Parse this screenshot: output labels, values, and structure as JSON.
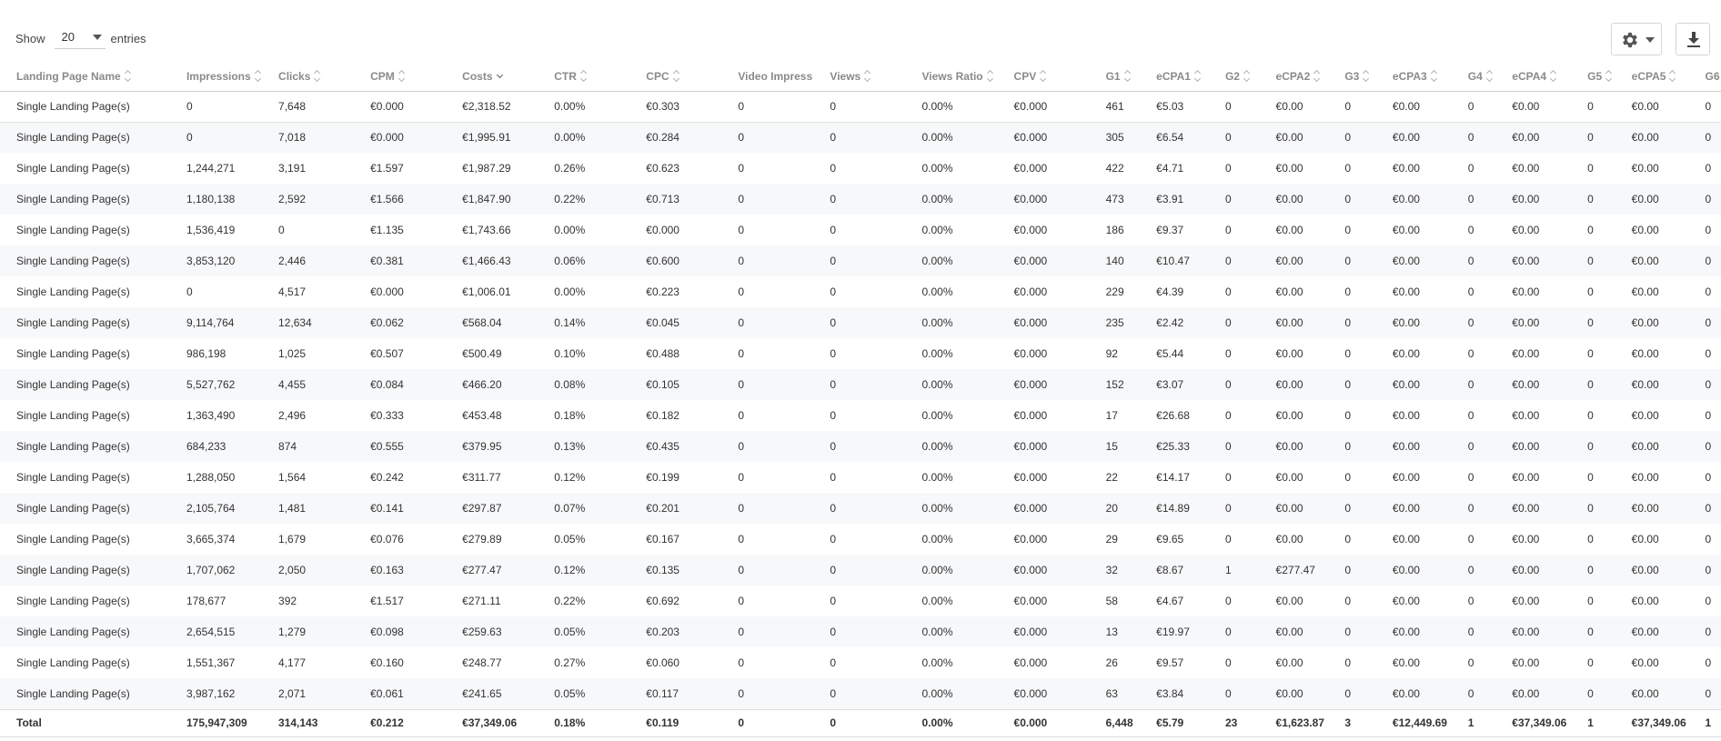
{
  "length_menu": {
    "prefix": "Show",
    "value": "20",
    "suffix": "entries"
  },
  "toolbar": {
    "settings_icon": "gear-icon",
    "download_icon": "download-icon"
  },
  "columns": [
    "Landing Page Name",
    "Impressions",
    "Clicks",
    "CPM",
    "Costs",
    "CTR",
    "CPC",
    "Video Impressions",
    "Views",
    "Views Ratio",
    "CPV",
    "G1",
    "eCPA1",
    "G2",
    "eCPA2",
    "G3",
    "eCPA3",
    "G4",
    "eCPA4",
    "G5",
    "eCPA5",
    "G6"
  ],
  "sorted_column": "Costs",
  "rows": [
    [
      "Single Landing Page(s)",
      "0",
      "7,648",
      "€0.000",
      "€2,318.52",
      "0.00%",
      "€0.303",
      "0",
      "0",
      "0.00%",
      "€0.000",
      "461",
      "€5.03",
      "0",
      "€0.00",
      "0",
      "€0.00",
      "0",
      "€0.00",
      "0",
      "€0.00",
      "0"
    ],
    [
      "Single Landing Page(s)",
      "0",
      "7,018",
      "€0.000",
      "€1,995.91",
      "0.00%",
      "€0.284",
      "0",
      "0",
      "0.00%",
      "€0.000",
      "305",
      "€6.54",
      "0",
      "€0.00",
      "0",
      "€0.00",
      "0",
      "€0.00",
      "0",
      "€0.00",
      "0"
    ],
    [
      "Single Landing Page(s)",
      "1,244,271",
      "3,191",
      "€1.597",
      "€1,987.29",
      "0.26%",
      "€0.623",
      "0",
      "0",
      "0.00%",
      "€0.000",
      "422",
      "€4.71",
      "0",
      "€0.00",
      "0",
      "€0.00",
      "0",
      "€0.00",
      "0",
      "€0.00",
      "0"
    ],
    [
      "Single Landing Page(s)",
      "1,180,138",
      "2,592",
      "€1.566",
      "€1,847.90",
      "0.22%",
      "€0.713",
      "0",
      "0",
      "0.00%",
      "€0.000",
      "473",
      "€3.91",
      "0",
      "€0.00",
      "0",
      "€0.00",
      "0",
      "€0.00",
      "0",
      "€0.00",
      "0"
    ],
    [
      "Single Landing Page(s)",
      "1,536,419",
      "0",
      "€1.135",
      "€1,743.66",
      "0.00%",
      "€0.000",
      "0",
      "0",
      "0.00%",
      "€0.000",
      "186",
      "€9.37",
      "0",
      "€0.00",
      "0",
      "€0.00",
      "0",
      "€0.00",
      "0",
      "€0.00",
      "0"
    ],
    [
      "Single Landing Page(s)",
      "3,853,120",
      "2,446",
      "€0.381",
      "€1,466.43",
      "0.06%",
      "€0.600",
      "0",
      "0",
      "0.00%",
      "€0.000",
      "140",
      "€10.47",
      "0",
      "€0.00",
      "0",
      "€0.00",
      "0",
      "€0.00",
      "0",
      "€0.00",
      "0"
    ],
    [
      "Single Landing Page(s)",
      "0",
      "4,517",
      "€0.000",
      "€1,006.01",
      "0.00%",
      "€0.223",
      "0",
      "0",
      "0.00%",
      "€0.000",
      "229",
      "€4.39",
      "0",
      "€0.00",
      "0",
      "€0.00",
      "0",
      "€0.00",
      "0",
      "€0.00",
      "0"
    ],
    [
      "Single Landing Page(s)",
      "9,114,764",
      "12,634",
      "€0.062",
      "€568.04",
      "0.14%",
      "€0.045",
      "0",
      "0",
      "0.00%",
      "€0.000",
      "235",
      "€2.42",
      "0",
      "€0.00",
      "0",
      "€0.00",
      "0",
      "€0.00",
      "0",
      "€0.00",
      "0"
    ],
    [
      "Single Landing Page(s)",
      "986,198",
      "1,025",
      "€0.507",
      "€500.49",
      "0.10%",
      "€0.488",
      "0",
      "0",
      "0.00%",
      "€0.000",
      "92",
      "€5.44",
      "0",
      "€0.00",
      "0",
      "€0.00",
      "0",
      "€0.00",
      "0",
      "€0.00",
      "0"
    ],
    [
      "Single Landing Page(s)",
      "5,527,762",
      "4,455",
      "€0.084",
      "€466.20",
      "0.08%",
      "€0.105",
      "0",
      "0",
      "0.00%",
      "€0.000",
      "152",
      "€3.07",
      "0",
      "€0.00",
      "0",
      "€0.00",
      "0",
      "€0.00",
      "0",
      "€0.00",
      "0"
    ],
    [
      "Single Landing Page(s)",
      "1,363,490",
      "2,496",
      "€0.333",
      "€453.48",
      "0.18%",
      "€0.182",
      "0",
      "0",
      "0.00%",
      "€0.000",
      "17",
      "€26.68",
      "0",
      "€0.00",
      "0",
      "€0.00",
      "0",
      "€0.00",
      "0",
      "€0.00",
      "0"
    ],
    [
      "Single Landing Page(s)",
      "684,233",
      "874",
      "€0.555",
      "€379.95",
      "0.13%",
      "€0.435",
      "0",
      "0",
      "0.00%",
      "€0.000",
      "15",
      "€25.33",
      "0",
      "€0.00",
      "0",
      "€0.00",
      "0",
      "€0.00",
      "0",
      "€0.00",
      "0"
    ],
    [
      "Single Landing Page(s)",
      "1,288,050",
      "1,564",
      "€0.242",
      "€311.77",
      "0.12%",
      "€0.199",
      "0",
      "0",
      "0.00%",
      "€0.000",
      "22",
      "€14.17",
      "0",
      "€0.00",
      "0",
      "€0.00",
      "0",
      "€0.00",
      "0",
      "€0.00",
      "0"
    ],
    [
      "Single Landing Page(s)",
      "2,105,764",
      "1,481",
      "€0.141",
      "€297.87",
      "0.07%",
      "€0.201",
      "0",
      "0",
      "0.00%",
      "€0.000",
      "20",
      "€14.89",
      "0",
      "€0.00",
      "0",
      "€0.00",
      "0",
      "€0.00",
      "0",
      "€0.00",
      "0"
    ],
    [
      "Single Landing Page(s)",
      "3,665,374",
      "1,679",
      "€0.076",
      "€279.89",
      "0.05%",
      "€0.167",
      "0",
      "0",
      "0.00%",
      "€0.000",
      "29",
      "€9.65",
      "0",
      "€0.00",
      "0",
      "€0.00",
      "0",
      "€0.00",
      "0",
      "€0.00",
      "0"
    ],
    [
      "Single Landing Page(s)",
      "1,707,062",
      "2,050",
      "€0.163",
      "€277.47",
      "0.12%",
      "€0.135",
      "0",
      "0",
      "0.00%",
      "€0.000",
      "32",
      "€8.67",
      "1",
      "€277.47",
      "0",
      "€0.00",
      "0",
      "€0.00",
      "0",
      "€0.00",
      "0"
    ],
    [
      "Single Landing Page(s)",
      "178,677",
      "392",
      "€1.517",
      "€271.11",
      "0.22%",
      "€0.692",
      "0",
      "0",
      "0.00%",
      "€0.000",
      "58",
      "€4.67",
      "0",
      "€0.00",
      "0",
      "€0.00",
      "0",
      "€0.00",
      "0",
      "€0.00",
      "0"
    ],
    [
      "Single Landing Page(s)",
      "2,654,515",
      "1,279",
      "€0.098",
      "€259.63",
      "0.05%",
      "€0.203",
      "0",
      "0",
      "0.00%",
      "€0.000",
      "13",
      "€19.97",
      "0",
      "€0.00",
      "0",
      "€0.00",
      "0",
      "€0.00",
      "0",
      "€0.00",
      "0"
    ],
    [
      "Single Landing Page(s)",
      "1,551,367",
      "4,177",
      "€0.160",
      "€248.77",
      "0.27%",
      "€0.060",
      "0",
      "0",
      "0.00%",
      "€0.000",
      "26",
      "€9.57",
      "0",
      "€0.00",
      "0",
      "€0.00",
      "0",
      "€0.00",
      "0",
      "€0.00",
      "0"
    ],
    [
      "Single Landing Page(s)",
      "3,987,162",
      "2,071",
      "€0.061",
      "€241.65",
      "0.05%",
      "€0.117",
      "0",
      "0",
      "0.00%",
      "€0.000",
      "63",
      "€3.84",
      "0",
      "€0.00",
      "0",
      "€0.00",
      "0",
      "€0.00",
      "0",
      "€0.00",
      "0"
    ]
  ],
  "totals": [
    "Total",
    "175,947,309",
    "314,143",
    "€0.212",
    "€37,349.06",
    "0.18%",
    "€0.119",
    "0",
    "0",
    "0.00%",
    "€0.000",
    "6,448",
    "€5.79",
    "23",
    "€1,623.87",
    "3",
    "€12,449.69",
    "1",
    "€37,349.06",
    "1",
    "€37,349.06",
    "1"
  ]
}
